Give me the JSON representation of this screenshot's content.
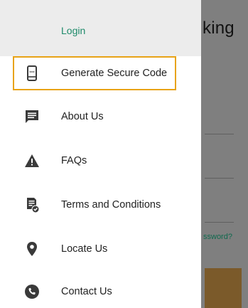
{
  "background": {
    "title_fragment": "king",
    "forgot_fragment": "ssword?"
  },
  "drawer": {
    "login_label": "Login",
    "items": [
      {
        "label": "Generate Secure Code",
        "icon": "mobile-phone-icon"
      },
      {
        "label": "About Us",
        "icon": "message-icon"
      },
      {
        "label": "FAQs",
        "icon": "warning-icon"
      },
      {
        "label": "Terms and Conditions",
        "icon": "document-check-icon"
      },
      {
        "label": "Locate Us",
        "icon": "location-pin-icon"
      },
      {
        "label": "Contact Us",
        "icon": "phone-icon"
      }
    ]
  },
  "colors": {
    "accent_green": "#1e8a6a",
    "highlight_border": "#e8a317",
    "overlay": "#7f7f7f"
  }
}
